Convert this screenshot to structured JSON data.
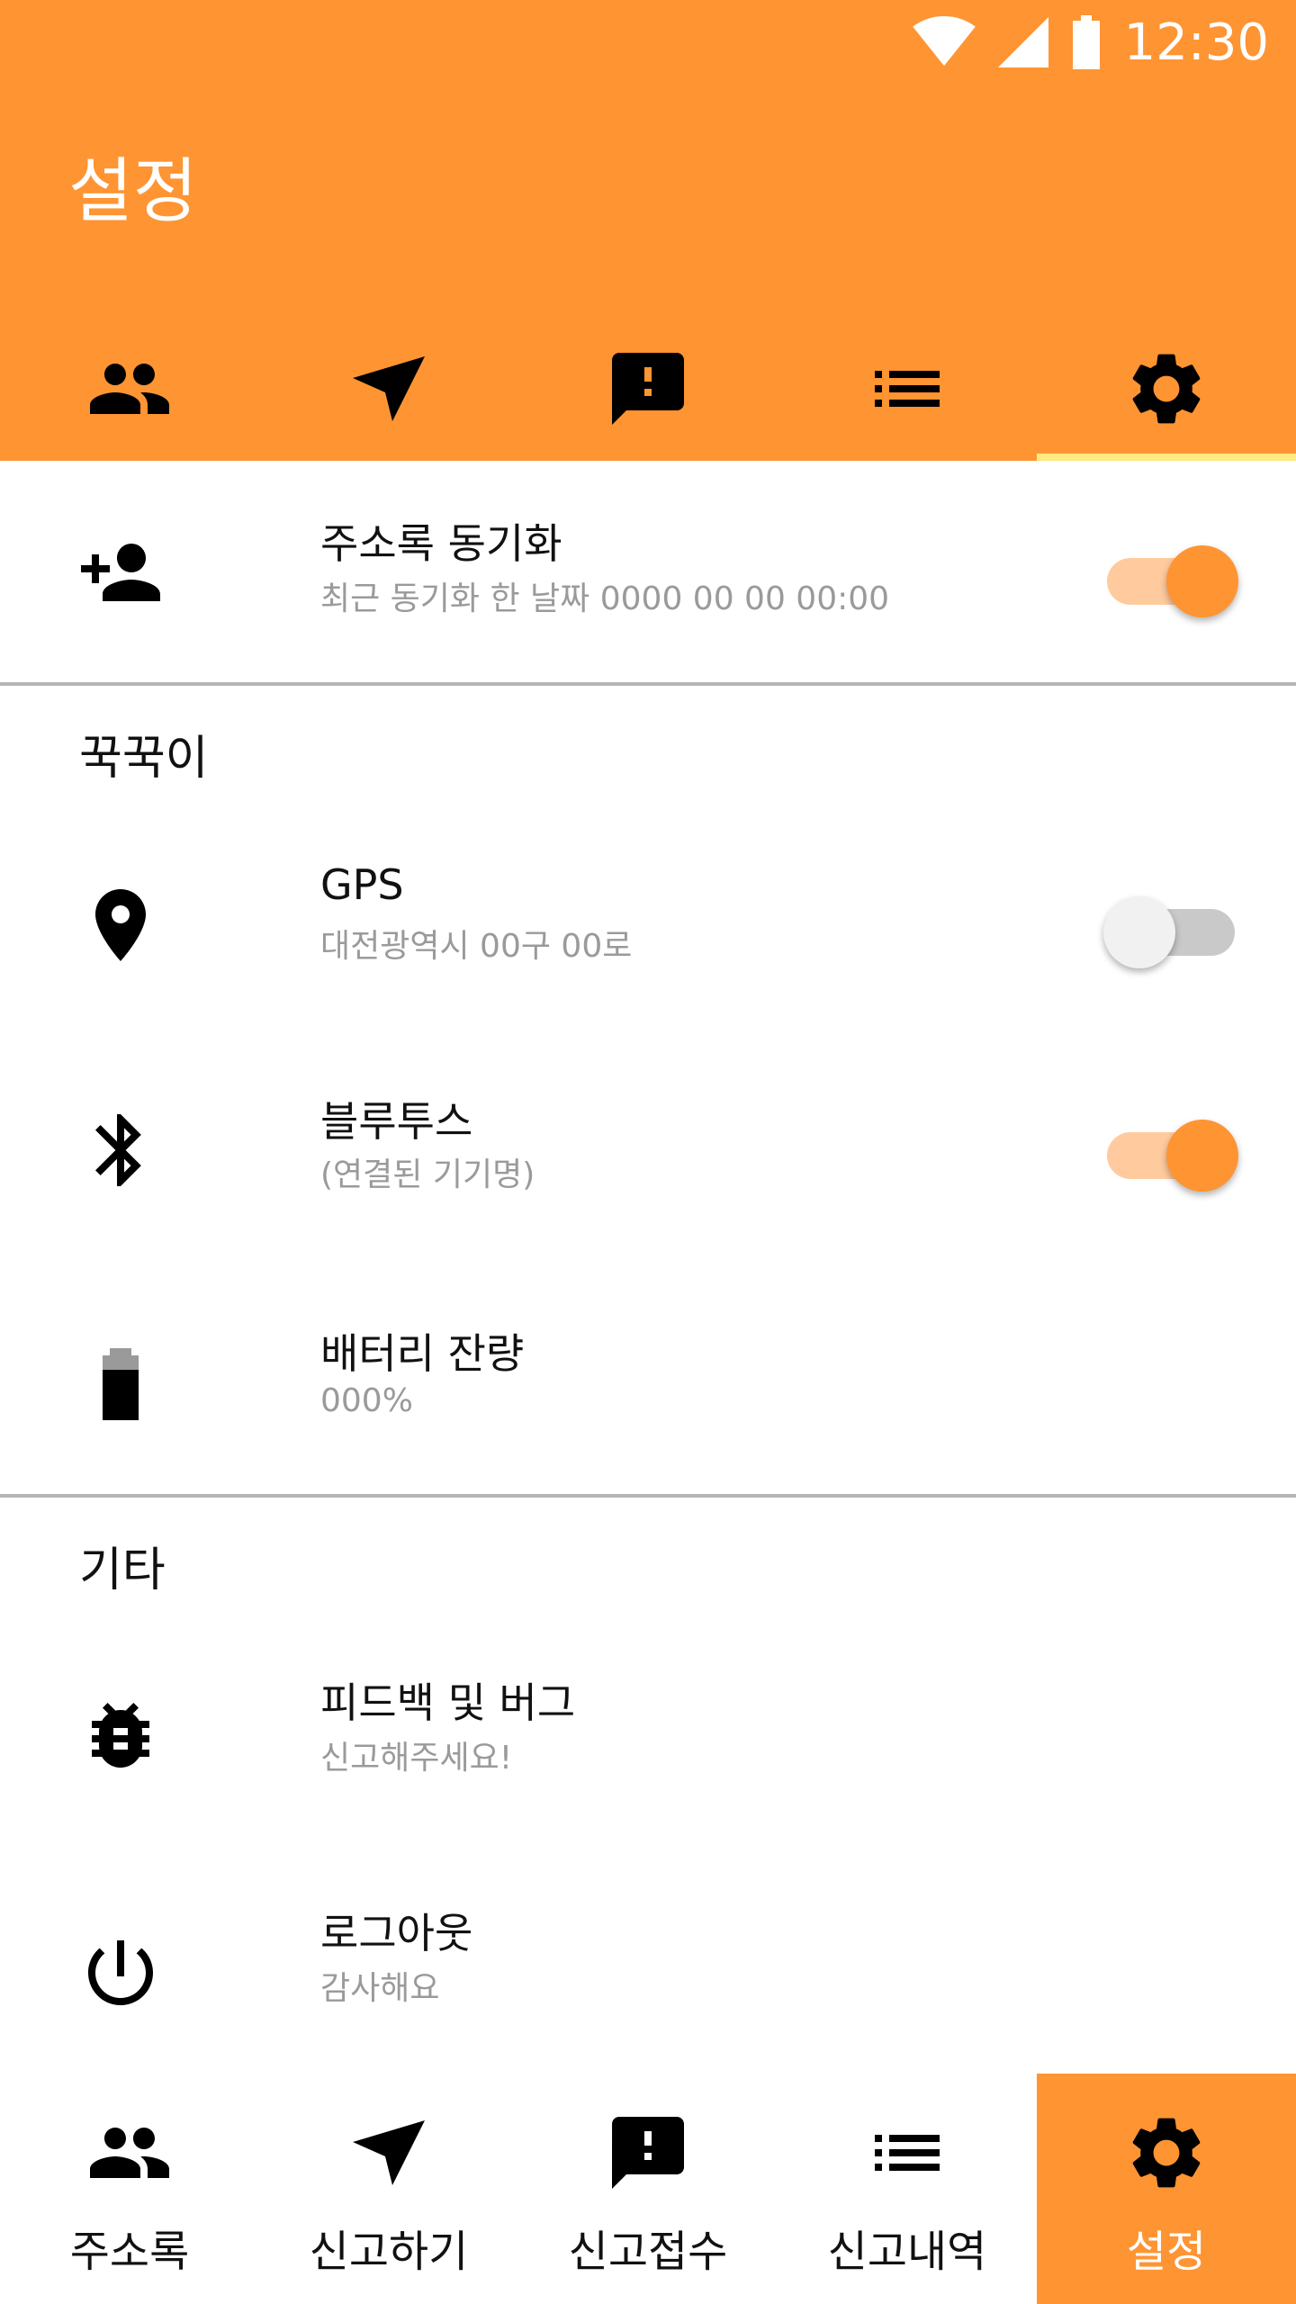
{
  "status_bar": {
    "time": "12:30"
  },
  "page_title": "설정",
  "top_tabs": [
    {
      "icon": "people-icon"
    },
    {
      "icon": "send-icon"
    },
    {
      "icon": "report-message-icon"
    },
    {
      "icon": "list-icon"
    },
    {
      "icon": "settings-gear-icon",
      "active": true
    }
  ],
  "sync": {
    "title": "주소록 동기화",
    "subtitle": "최근 동기화 한 날짜 0000 00 00 00:00",
    "toggle": "on"
  },
  "section_device": {
    "header": "꾹꾹이",
    "gps": {
      "title": "GPS",
      "subtitle": "대전광역시 00구 00로",
      "toggle": "off"
    },
    "bluetooth": {
      "title": "블루투스",
      "subtitle": "(연결된 기기명)",
      "toggle": "on"
    },
    "battery": {
      "title": "배터리 잔량",
      "subtitle": "000%"
    }
  },
  "section_etc": {
    "header": "기타",
    "feedback": {
      "title": "피드백 및 버그",
      "subtitle": "신고해주세요!"
    },
    "logout": {
      "title": "로그아웃",
      "subtitle": "감사해요"
    }
  },
  "bottom_nav": [
    {
      "label": "주소록",
      "icon": "people-icon"
    },
    {
      "label": "신고하기",
      "icon": "send-icon"
    },
    {
      "label": "신고접수",
      "icon": "report-message-icon"
    },
    {
      "label": "신고내역",
      "icon": "list-icon"
    },
    {
      "label": "설정",
      "icon": "settings-gear-icon",
      "active": true
    }
  ],
  "colors": {
    "accent": "#FF9433",
    "tab_indicator": "#FFEB80",
    "divider": "#B5B5B5",
    "subtitle": "#9A9A9A"
  }
}
